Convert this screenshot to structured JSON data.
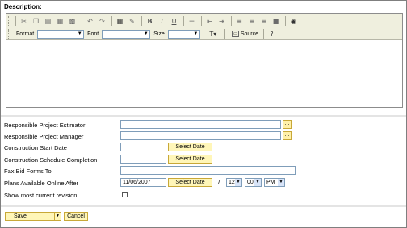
{
  "description_label": "Description:",
  "toolbar": {
    "format_label": "Format",
    "font_label": "Font",
    "size_label": "Size",
    "source_label": "Source",
    "bold": "B",
    "italic": "I",
    "underline": "U"
  },
  "fields": {
    "estimator_label": "Responsible Project Estimator",
    "manager_label": "Responsible Project Manager",
    "start_label": "Construction Start Date",
    "completion_label": "Construction Schedule Completion",
    "fax_label": "Fax Bid Forms To",
    "online_label": "Plans Available Online After",
    "revision_label": "Show most current revision",
    "online_date": "11/06/2007",
    "hour": "12",
    "minute": "00",
    "ampm": "PM",
    "slash": "/",
    "ellipsis": "...",
    "select_date": "Select Date"
  },
  "buttons": {
    "save": "Save",
    "cancel": "Cancel"
  }
}
